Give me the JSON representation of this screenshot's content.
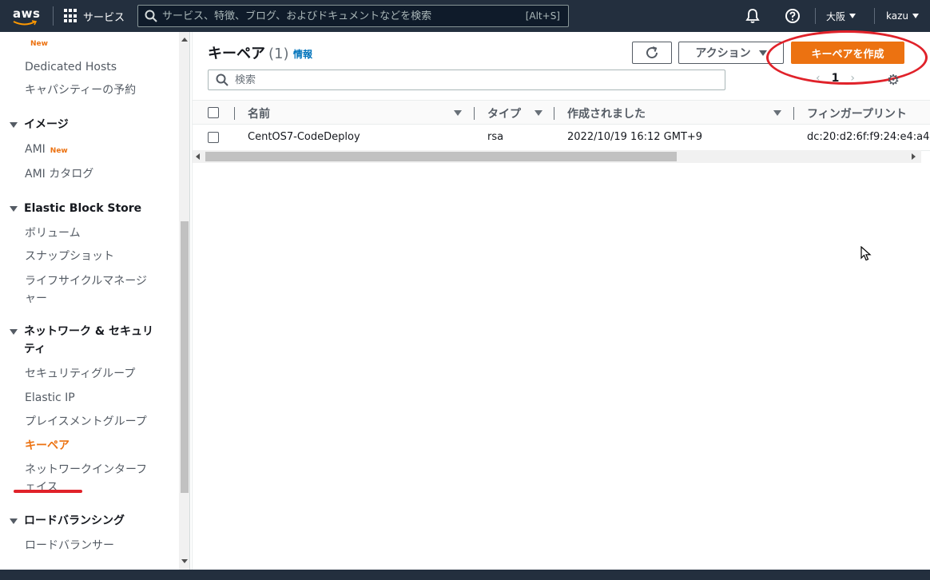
{
  "topnav": {
    "logo": "aws",
    "services_label": "サービス",
    "search_placeholder": "サービス、特徴、ブログ、およびドキュメントなどを検索",
    "search_shortcut": "[Alt+S]",
    "region": "大阪",
    "user": "kazu",
    "icons": [
      "grid-icon",
      "search-icon",
      "bell-icon",
      "help-icon"
    ]
  },
  "sidebar": {
    "new_badge": "New",
    "items": [
      {
        "label": "Dedicated Hosts"
      },
      {
        "label": "キャパシティーの予約"
      }
    ],
    "images_header": "イメージ",
    "ami": "AMI",
    "ami_catalog": "AMI カタログ",
    "ebs_header": "Elastic Block Store",
    "volumes": "ボリューム",
    "snapshots": "スナップショット",
    "lifecycle": "ライフサイクルマネージャー",
    "lifecycle_line1": "ライフサイクルマネージ",
    "lifecycle_line2": "ャー",
    "network_header_line1": "ネットワーク & セキュリ",
    "network_header_line2": "ティ",
    "security_groups": "セキュリティグループ",
    "elastic_ip": "Elastic IP",
    "placement_groups": "プレイスメントグループ",
    "key_pairs": "キーペア",
    "eni_line1": "ネットワークインターフ",
    "eni_line2": "ェイス",
    "lb_header": "ロードバランシング",
    "load_balancers": "ロードバランサー"
  },
  "main": {
    "title": "キーペア",
    "count": "(1)",
    "info": "情報",
    "action_label": "アクション",
    "create_label": "キーペアを作成",
    "search_placeholder": "検索",
    "page_number": "1",
    "columns": [
      "名前",
      "タイプ",
      "作成されました",
      "フィンガープリント"
    ],
    "rows": [
      {
        "name": "CentOS7-CodeDeploy",
        "type": "rsa",
        "created": "2022/10/19 16:12 GMT+9",
        "fingerprint": "dc:20:d2:6f:f9:24:e4:a4"
      }
    ]
  },
  "colors": {
    "nav_bg": "#232f3e",
    "accent": "#ec7211",
    "annotation_red": "#e0222a",
    "link": "#0073bb"
  }
}
